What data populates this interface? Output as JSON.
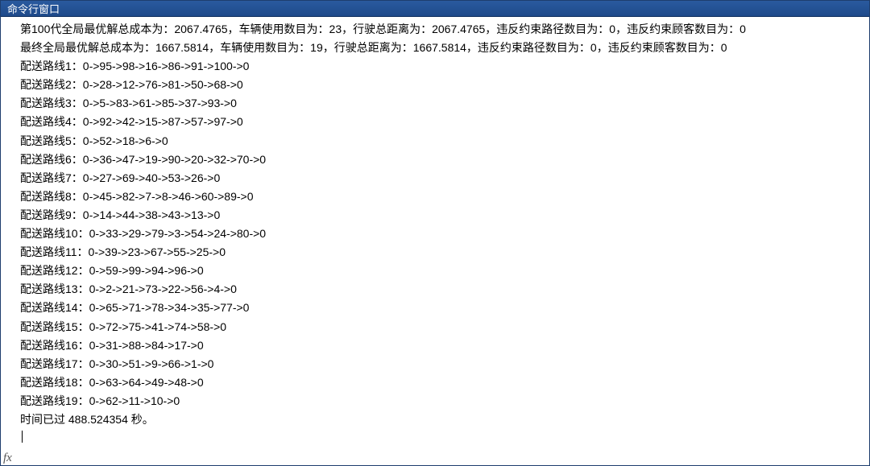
{
  "window": {
    "title": "命令行窗口"
  },
  "output": {
    "gen_line": "第100代全局最优解总成本为：2067.4765，车辆使用数目为：23，行驶总距离为：2067.4765，违反约束路径数目为：0，违反约束顾客数目为：0",
    "final_line": "最终全局最优解总成本为：1667.5814，车辆使用数目为：19，行驶总距离为：1667.5814，违反约束路径数目为：0，违反约束顾客数目为：0",
    "routes": [
      "配送路线1：0->95->98->16->86->91->100->0",
      "配送路线2：0->28->12->76->81->50->68->0",
      "配送路线3：0->5->83->61->85->37->93->0",
      "配送路线4：0->92->42->15->87->57->97->0",
      "配送路线5：0->52->18->6->0",
      "配送路线6：0->36->47->19->90->20->32->70->0",
      "配送路线7：0->27->69->40->53->26->0",
      "配送路线8：0->45->82->7->8->46->60->89->0",
      "配送路线9：0->14->44->38->43->13->0",
      "配送路线10：0->33->29->79->3->54->24->80->0",
      "配送路线11：0->39->23->67->55->25->0",
      "配送路线12：0->59->99->94->96->0",
      "配送路线13：0->2->21->73->22->56->4->0",
      "配送路线14：0->65->71->78->34->35->77->0",
      "配送路线15：0->72->75->41->74->58->0",
      "配送路线16：0->31->88->84->17->0",
      "配送路线17：0->30->51->9->66->1->0",
      "配送路线18：0->63->64->49->48->0",
      "配送路线19：0->62->11->10->0"
    ],
    "elapsed": "时间已过 488.524354 秒。"
  },
  "fx_label": "fx",
  "prompt_symbol": ">>"
}
